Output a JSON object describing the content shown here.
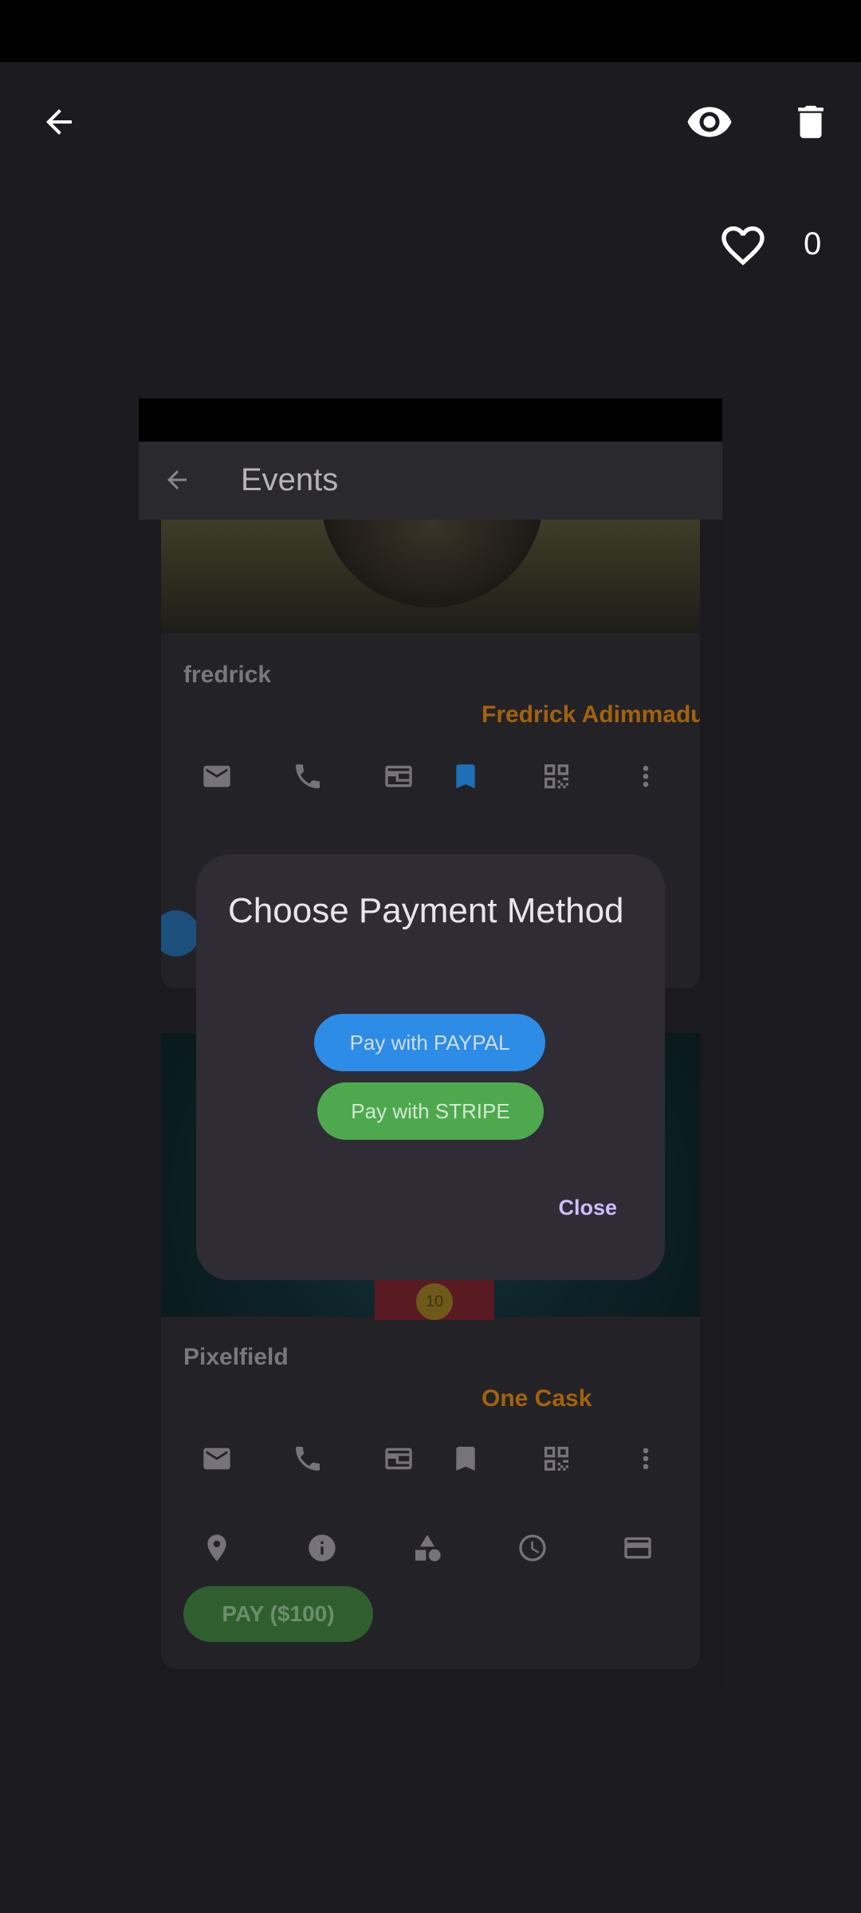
{
  "header": {
    "back_icon": "arrow-left-icon",
    "view_icon": "eye-icon",
    "delete_icon": "trash-icon"
  },
  "likes": {
    "icon": "heart-outline-icon",
    "count": "0"
  },
  "preview": {
    "appbar_title": "Events",
    "cards": [
      {
        "name": "fredrick",
        "organizer": "Fredrick Adimmadu J"
      },
      {
        "name": "Pixelfield",
        "organizer": "One Cask",
        "pay_label": "PAY ($100)",
        "coin_label": "10"
      }
    ],
    "colors": {
      "organizer": "#a3620f",
      "bookmark_active": "#1e6fb8"
    }
  },
  "dialog": {
    "title": "Choose Payment Method",
    "paypal_label": "Pay with PAYPAL",
    "stripe_label": "Pay with STRIPE",
    "close_label": "Close",
    "colors": {
      "paypal": "#2c8ce6",
      "stripe": "#4ea94e",
      "close": "#d0bcff"
    }
  }
}
